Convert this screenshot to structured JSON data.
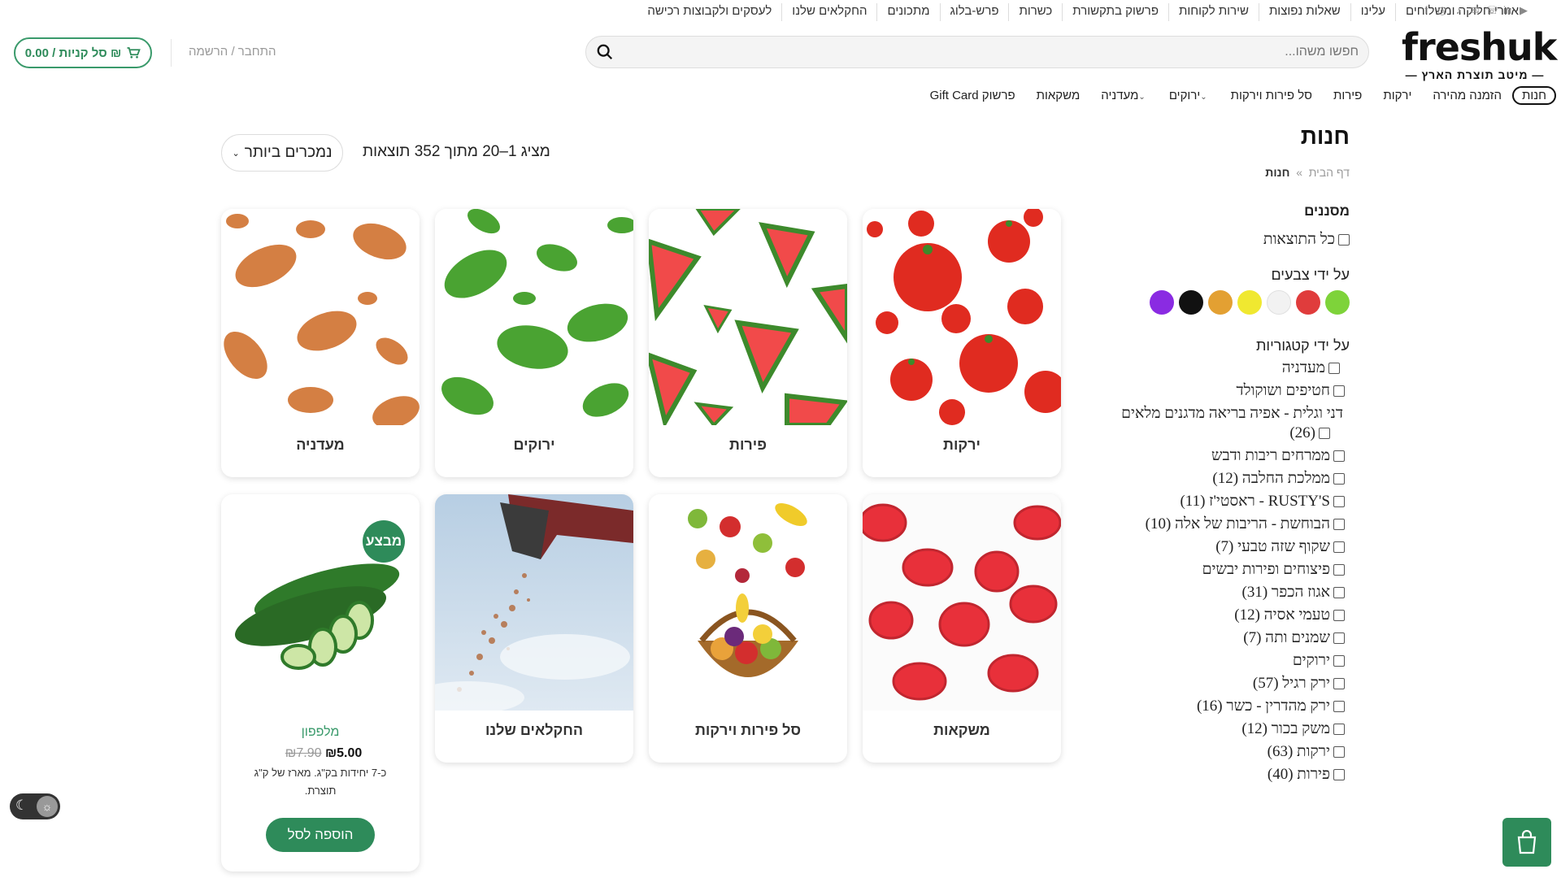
{
  "topbar": {
    "links": [
      "אזורי חלוקה ומשלוחים",
      "עלינו",
      "שאלות נפוצות",
      "שירות לקוחות",
      "פרשוק בתקשורת",
      "כשרות",
      "פרש-בלוג",
      "מתכונים",
      "החקלאים שלנו",
      "לעסקים ולקבוצות רכישה"
    ],
    "social": [
      "facebook-icon",
      "instagram-icon",
      "tiktok-icon",
      "email-icon",
      "phone-icon",
      "linkedin-icon",
      "youtube-icon"
    ]
  },
  "header": {
    "logo_text": "freshuk",
    "logo_tagline": "מיטב תוצרת הארץ",
    "search_placeholder": "חפשו משהו...",
    "login_label": "התחבר / הרשמה",
    "cart_label": "סל קניות / 0.00 ₪"
  },
  "mainnav": {
    "items": [
      {
        "label": "חנות",
        "active": true,
        "dropdown": false
      },
      {
        "label": "הזמנה מהירה",
        "active": false,
        "dropdown": false
      },
      {
        "label": "ירקות",
        "active": false,
        "dropdown": false
      },
      {
        "label": "פירות",
        "active": false,
        "dropdown": false
      },
      {
        "label": "סל פירות וירקות",
        "active": false,
        "dropdown": false
      },
      {
        "label": "ירוקים",
        "active": false,
        "dropdown": true
      },
      {
        "label": "מעדניה",
        "active": false,
        "dropdown": true
      },
      {
        "label": "משקאות",
        "active": false,
        "dropdown": false
      },
      {
        "label": "Gift Card פרשוק",
        "active": false,
        "dropdown": false
      }
    ]
  },
  "page": {
    "title": "חנות",
    "breadcrumb_home": "דף הבית",
    "breadcrumb_sep": "»",
    "breadcrumb_current": "חנות",
    "results_text": "מציג 1–20 מתוך 352 תוצאות",
    "sort_label": "נמכרים ביותר"
  },
  "sidebar": {
    "filters_title": "מסננים",
    "all_results": "כל התוצאות",
    "colors_title": "על ידי צבעים",
    "colors": [
      "#7ed33a",
      "#e03c3c",
      "#f2f2f2",
      "#f0e830",
      "#e3a032",
      "#111111",
      "#8a2be2"
    ],
    "categories_title": "על ידי קטגוריות",
    "categories": [
      "מעדניה",
      "חטיפים ושוקולד",
      "דני וגלית - אפיה בריאה מדגנים מלאים",
      "(26)",
      "ממרחים ריבות ודבש",
      "ממלכת החלבה (12)",
      "RUSTY'S - ראסטי'ז (11)",
      "הבוחשת - הריבות של אלה (10)",
      "שקוף שזה טבעי (7)",
      "פיצוחים ופירות יבשים",
      "אגוז הכפר (31)",
      "טעמי אסיה (12)",
      "שמנים ותה (7)",
      "ירוקים",
      "ירק רגיל (57)",
      "ירק מהדרין - כשר (16)",
      "משק בכור (12)",
      "ירקות (63)",
      "פירות (40)"
    ]
  },
  "grid": {
    "categories": [
      "ירקות",
      "פירות",
      "ירוקים",
      "מעדניה",
      "משקאות",
      "סל פירות וירקות",
      "החקלאים שלנו"
    ],
    "product": {
      "badge": "מבצע",
      "name": "מלפפון",
      "old_price": "₪7.90",
      "new_price": "₪5.00",
      "desc": "כ-7 יחידות בק\"ג. מארז של ק\"ג תוצרת.",
      "add_label": "הוספה לסל"
    }
  },
  "colors": {
    "accent": "#2e8b5a"
  }
}
